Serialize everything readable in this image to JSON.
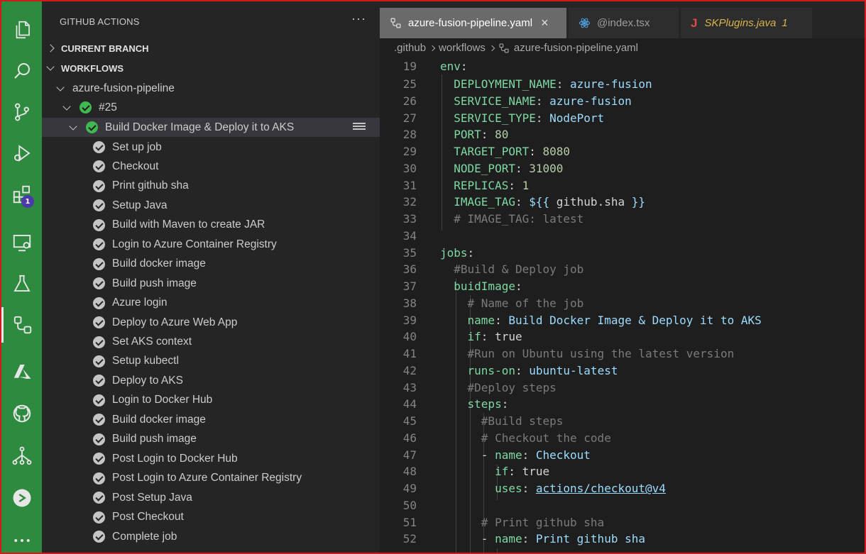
{
  "activity_bar": {
    "items": [
      {
        "name": "explorer-icon"
      },
      {
        "name": "search-icon"
      },
      {
        "name": "source-control-icon"
      },
      {
        "name": "run-debug-icon"
      },
      {
        "name": "extensions-icon",
        "badge": "1"
      },
      {
        "name": "remote-explorer-icon"
      },
      {
        "name": "testing-icon"
      },
      {
        "name": "github-actions-icon"
      },
      {
        "name": "azure-icon"
      },
      {
        "name": "github-icon"
      },
      {
        "name": "kubernetes-icon"
      },
      {
        "name": "gitlens-icon"
      },
      {
        "name": "more-icon"
      }
    ]
  },
  "sidebar": {
    "title": "GITHUB ACTIONS",
    "more": "···",
    "sections": {
      "current_branch": "CURRENT BRANCH",
      "workflows": "WORKFLOWS"
    },
    "workflow_name": "azure-fusion-pipeline",
    "run": "#25",
    "job": "Build Docker Image & Deploy it to AKS",
    "steps": [
      "Set up job",
      "Checkout",
      "Print github sha",
      "Setup Java",
      "Build with Maven to create JAR",
      "Login to Azure Container Registry",
      "Build docker image",
      "Build push image",
      "Azure login",
      "Deploy to Azure Web App",
      "Set AKS context",
      "Setup kubectl",
      "Deploy to AKS",
      "Login to Docker Hub",
      "Build docker image",
      "Build push image",
      "Post Login to Docker Hub",
      "Post Login to Azure Container Registry",
      "Post Setup Java",
      "Post Checkout",
      "Complete job"
    ]
  },
  "tabs": [
    {
      "label": "azure-fusion-pipeline.yaml",
      "close": "×",
      "active": true
    },
    {
      "label": "@index.tsx",
      "active": false
    },
    {
      "label": "SKPlugins.java",
      "badge": "1",
      "active": false
    }
  ],
  "breadcrumb": [
    ".github",
    "workflows",
    "azure-fusion-pipeline.yaml"
  ],
  "colors": {
    "activity_bar": "#2d8a3e",
    "sidebar": "#252526",
    "editor": "#1e1e1e",
    "success": "#3fb950",
    "frame": "#d11a1a"
  }
}
